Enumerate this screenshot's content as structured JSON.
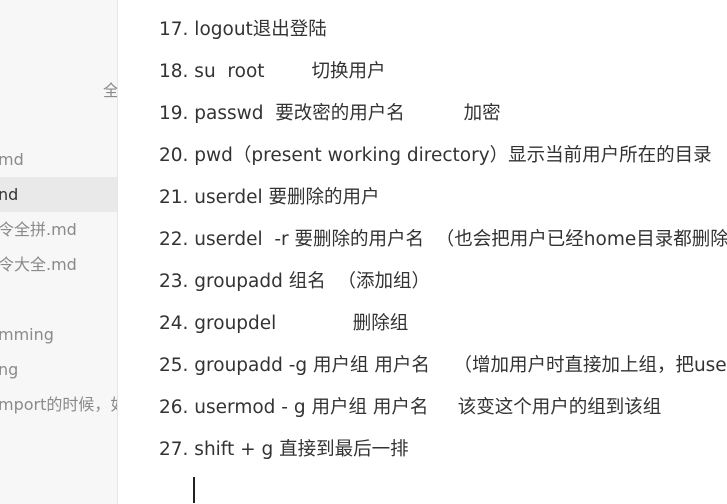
{
  "sidebar": {
    "items": [
      {
        "label": "全",
        "active": false
      },
      {
        "label": "md",
        "active": false
      },
      {
        "label": "nd",
        "active": true
      },
      {
        "label": "令全拼.md",
        "active": false
      },
      {
        "label": "令大全.md",
        "active": false
      },
      {
        "label": "mming",
        "active": false
      },
      {
        "label": "ng",
        "active": false
      },
      {
        "label": "mport的时候，如",
        "active": false
      }
    ]
  },
  "editor": {
    "lines": [
      "17. logout退出登陆",
      "18. su  root        切换用户",
      "19. passwd  要改密的用户名          加密",
      "20. pwd（present working directory）显示当前用户所在的目录",
      "21. userdel 要删除的用户",
      "22. userdel  -r 要删除的用户名  （也会把用户已经home目录都删除",
      "23. groupadd 组名  （添加组）",
      "24. groupdel             删除组",
      "25. groupadd -g 用户组 用户名    （增加用户时直接加上组，把user",
      "26. usermod - g 用户组 用户名     该变这个用户的组到该组",
      "27. shift + g 直接到最后一排"
    ]
  }
}
